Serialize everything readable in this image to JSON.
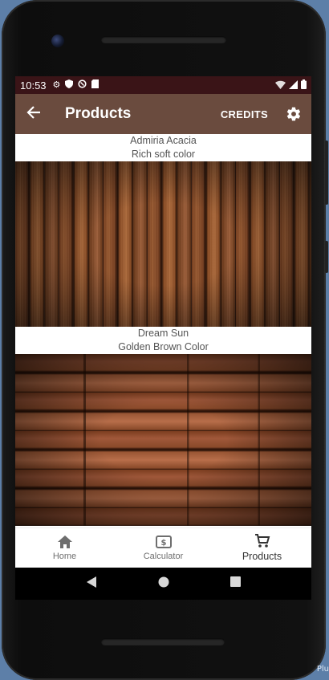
{
  "statusbar": {
    "time": "10:53"
  },
  "appbar": {
    "back_icon": "arrow-back-icon",
    "title": "Products",
    "credits_label": "CREDITS",
    "settings_icon": "gear-icon"
  },
  "products": [
    {
      "name": "Admiria Acacia",
      "description": "Rich soft color"
    },
    {
      "name": "Dream Sun",
      "description": "Golden Brown Color"
    }
  ],
  "bottom_nav": {
    "items": [
      {
        "label": "Home",
        "icon": "home-icon",
        "active": false
      },
      {
        "label": "Calculator",
        "icon": "calculator-icon",
        "active": false
      },
      {
        "label": "Products",
        "icon": "cart-icon",
        "active": true
      }
    ]
  },
  "theme": {
    "statusbar_color": "#3a1417",
    "appbar_color": "#6a4b3e"
  },
  "corner_text": "Plu"
}
